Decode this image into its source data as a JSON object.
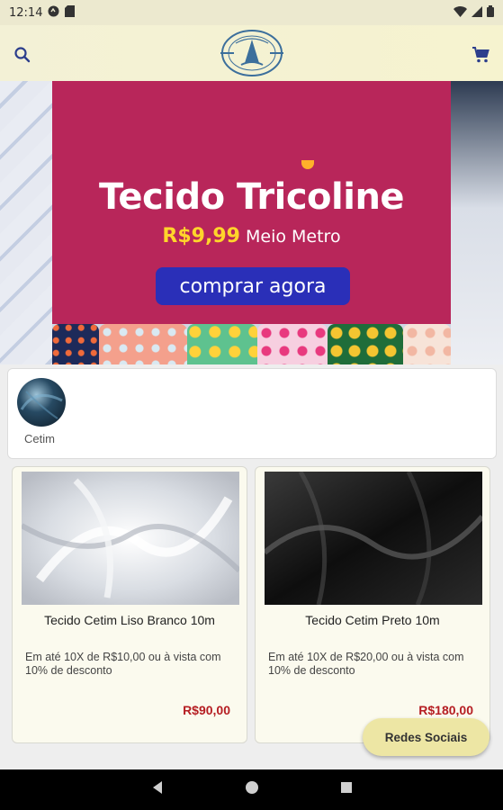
{
  "status_bar": {
    "time": "12:14"
  },
  "app_bar": {
    "search_icon": "search-icon",
    "cart_icon": "cart-icon",
    "logo_alt": "store logo"
  },
  "banner": {
    "title": "Tecido Tricoline",
    "price": "R$9,99",
    "price_unit": "Meio Metro",
    "cta_label": "comprar agora"
  },
  "categories": [
    {
      "label": "Cetim"
    }
  ],
  "products": [
    {
      "name": "Tecido Cetim Liso Branco 10m",
      "description": "Em até 10X de R$10,00 ou à vista com 10% de desconto",
      "price": "R$90,00"
    },
    {
      "name": "Tecido Cetim Preto 10m",
      "description": "Em até 10X de R$20,00 ou à vista com 10% de desconto",
      "price": "R$180,00"
    }
  ],
  "fab": {
    "label": "Redes Sociais"
  },
  "colors": {
    "appbar": "#f3f1d6",
    "banner_panel": "#b8265a",
    "banner_price": "#ffd52b",
    "cta": "#2a2fb8",
    "product_price": "#b51d22",
    "fab": "#ede6a4"
  }
}
